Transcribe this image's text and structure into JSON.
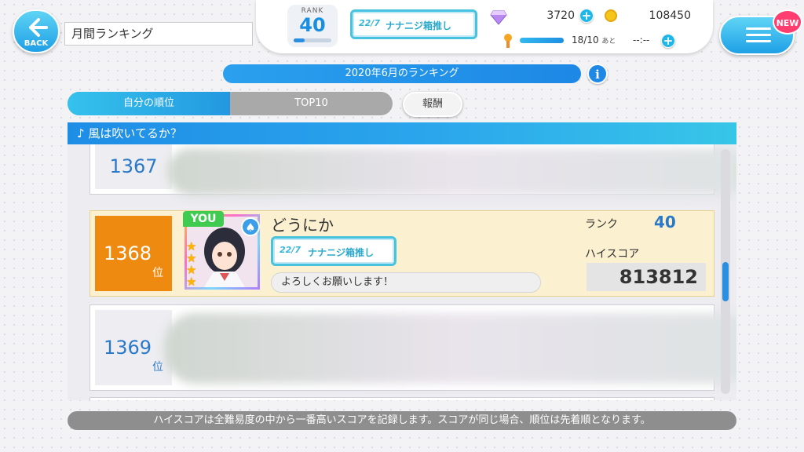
{
  "nav": {
    "back_label": "BACK",
    "page_title": "月間ランキング",
    "new_label": "NEW"
  },
  "status": {
    "rank_label": "RANK",
    "rank_value": "40",
    "title_logo": "22/7",
    "title_badge": "ナナニジ箱推し",
    "gems": "3720",
    "coins": "108450",
    "stamina": "18/10",
    "stamina_suffix": "あと",
    "stamina_timer": "--:--",
    "stamina_fraction": 1.0
  },
  "ranking": {
    "month_label": "2020年6月のランキング",
    "info_icon": "i",
    "tabs": [
      {
        "label": "自分の順位"
      },
      {
        "label": "TOP10"
      }
    ],
    "reward_label": "報酬",
    "song_title": "♪ 風は吹いてるか？",
    "rank_suffix": "位",
    "rows": [
      {
        "rank": "1367"
      },
      {
        "rank": "1368",
        "you_tag": "YOU",
        "name": "どうにか",
        "badge_logo": "22/7",
        "badge": "ナナニジ箱推し",
        "comment": "よろしくお願いします！",
        "rank_label": "ランク",
        "player_rank": "40",
        "score_label": "ハイスコア",
        "score": "813812",
        "stars": 4
      },
      {
        "rank": "1369"
      }
    ],
    "footer_note": "ハイスコアは全難易度の中から一番高いスコアを記録します。スコアが同じ場合、順位は先着順となります。"
  },
  "colors": {
    "accent": "#1d88e5",
    "you_highlight": "#ef8a10",
    "you_tag": "#3ecb50"
  }
}
